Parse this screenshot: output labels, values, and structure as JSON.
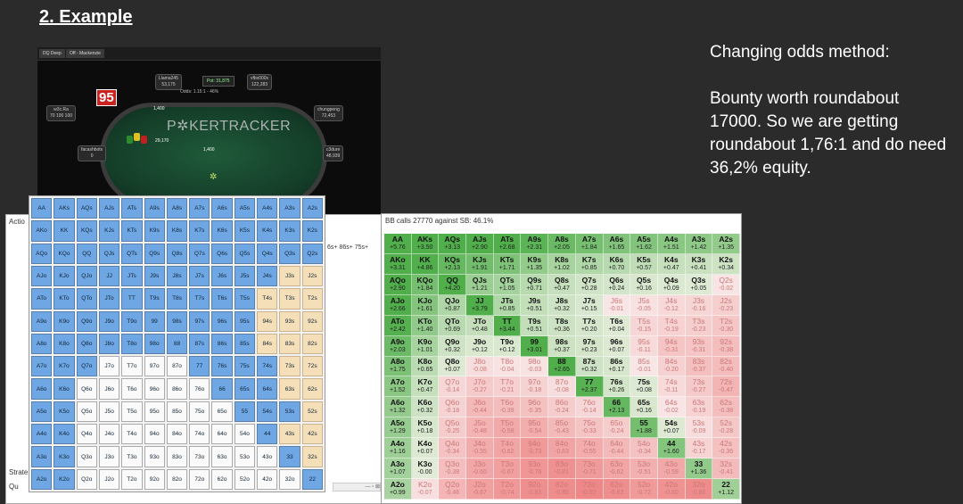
{
  "slide": {
    "title": "2. Example",
    "notes_heading": "Changing odds method:",
    "notes_body": "Bounty worth roundabout 17000. So we are getting roundabout 1,76:1 and do need 36,2% equity."
  },
  "table": {
    "tabs": [
      "DQ Deep",
      "Off - Mackenzie"
    ],
    "brand": "P✲KERTRACKER",
    "card_overlay": "95",
    "pot": "Pot: 31,875",
    "odds": "Odds: 1.15:1 - 46%",
    "stacks": {
      "top_left": "Llama245\n53,175",
      "top_right": "vfbx000x\n122,283",
      "left": "w3c.Ra\n70 100 100",
      "right_mid": "chungpeng\n72,453",
      "bottom_left": "facashbots\n0",
      "bottom_right": "c3dure\n48,939"
    },
    "bets": {
      "left": "1,400",
      "center": "29,170",
      "bottom": "1,400"
    }
  },
  "left_window": {
    "action_label": "Actio",
    "strategy_label": "Strate",
    "search_label": "Qu",
    "overflow_text": "6s+ 86s+ 75s+"
  },
  "range_grid": {
    "rows": [
      [
        "AA",
        "AKs",
        "AQs",
        "AJs",
        "ATs",
        "A9s",
        "A8s",
        "A7s",
        "A6s",
        "A5s",
        "A4s",
        "A3s",
        "A2s"
      ],
      [
        "AKo",
        "KK",
        "KQs",
        "KJs",
        "KTs",
        "K9s",
        "K8s",
        "K7s",
        "K6s",
        "K5s",
        "K4s",
        "K3s",
        "K2s"
      ],
      [
        "AQo",
        "KQo",
        "QQ",
        "QJs",
        "QTs",
        "Q9s",
        "Q8s",
        "Q7s",
        "Q6s",
        "Q5s",
        "Q4s",
        "Q3s",
        "Q2s"
      ],
      [
        "AJo",
        "KJo",
        "QJo",
        "JJ",
        "JTs",
        "J9s",
        "J8s",
        "J7s",
        "J6s",
        "J5s",
        "J4s",
        "J3s",
        "J2s"
      ],
      [
        "ATo",
        "KTo",
        "QTo",
        "JTo",
        "TT",
        "T9s",
        "T8s",
        "T7s",
        "T6s",
        "T5s",
        "T4s",
        "T3s",
        "T2s"
      ],
      [
        "A9o",
        "K9o",
        "Q9o",
        "J9o",
        "T9o",
        "99",
        "98s",
        "97s",
        "96s",
        "95s",
        "94s",
        "93s",
        "92s"
      ],
      [
        "A8o",
        "K8o",
        "Q8o",
        "J8o",
        "T8o",
        "98o",
        "88",
        "87s",
        "86s",
        "85s",
        "84s",
        "83s",
        "82s"
      ],
      [
        "A7o",
        "K7o",
        "Q7o",
        "J7o",
        "T7o",
        "97o",
        "87o",
        "77",
        "76s",
        "75s",
        "74s",
        "73s",
        "72s"
      ],
      [
        "A6o",
        "K6o",
        "Q6o",
        "J6o",
        "T6o",
        "96o",
        "86o",
        "76o",
        "66",
        "65s",
        "64s",
        "63s",
        "62s"
      ],
      [
        "A5o",
        "K5o",
        "Q5o",
        "J5o",
        "T5o",
        "95o",
        "85o",
        "75o",
        "65o",
        "55",
        "54s",
        "53s",
        "52s"
      ],
      [
        "A4o",
        "K4o",
        "Q4o",
        "J4o",
        "T4o",
        "94o",
        "84o",
        "74o",
        "64o",
        "54o",
        "44",
        "43s",
        "42s"
      ],
      [
        "A3o",
        "K3o",
        "Q3o",
        "J3o",
        "T3o",
        "93o",
        "83o",
        "73o",
        "63o",
        "53o",
        "43o",
        "33",
        "32s"
      ],
      [
        "A2o",
        "K2o",
        "Q2o",
        "J2o",
        "T2o",
        "92o",
        "82o",
        "72o",
        "62o",
        "52o",
        "42o",
        "32o",
        "22"
      ]
    ]
  },
  "equity": {
    "header": "BB calls 27770 against SB: 46.1%",
    "values": [
      [
        "+5.76",
        "+3.50",
        "+3.13",
        "+2.90",
        "+2.68",
        "+2.31",
        "+2.05",
        "+1.84",
        "+1.65",
        "+1.62",
        "+1.51",
        "+1.42",
        "+1.35"
      ],
      [
        "+3.31",
        "+4.86",
        "+2.13",
        "+1.91",
        "+1.71",
        "+1.35",
        "+1.02",
        "+0.85",
        "+0.70",
        "+0.57",
        "+0.47",
        "+0.41",
        "+0.34"
      ],
      [
        "+2.90",
        "+1.84",
        "+4.20",
        "+1.21",
        "+1.05",
        "+0.71",
        "+0.47",
        "+0.28",
        "+0.24",
        "+0.16",
        "+0.09",
        "+0.05",
        "-0.02"
      ],
      [
        "+2.66",
        "+1.61",
        "+0.87",
        "+3.79",
        "+0.85",
        "+0.51",
        "+0.32",
        "+0.15",
        "-0.01",
        "-0.05",
        "-0.12",
        "-0.16",
        "-0.23"
      ],
      [
        "+2.42",
        "+1.40",
        "+0.69",
        "+0.48",
        "+3.44",
        "+0.51",
        "+0.36",
        "+0.20",
        "+0.04",
        "-0.15",
        "-0.19",
        "-0.23",
        "-0.30"
      ],
      [
        "+2.03",
        "+1.01",
        "+0.32",
        "+0.12",
        "+0.12",
        "+3.01",
        "+0.37",
        "+0.23",
        "+0.07",
        "-0.11",
        "-0.31",
        "-0.31",
        "-0.38"
      ],
      [
        "+1.75",
        "+0.65",
        "+0.07",
        "-0.08",
        "-0.04",
        "-0.03",
        "+2.65",
        "+0.32",
        "+0.17",
        "-0.01",
        "-0.20",
        "-0.37",
        "-0.40"
      ],
      [
        "+1.52",
        "+0.47",
        "-0.14",
        "-0.27",
        "-0.21",
        "-0.18",
        "-0.08",
        "+2.37",
        "+0.26",
        "+0.08",
        "-0.11",
        "-0.27",
        "-0.47"
      ],
      [
        "+1.32",
        "+0.32",
        "-0.18",
        "-0.44",
        "-0.39",
        "-0.35",
        "-0.24",
        "-0.14",
        "+2.13",
        "+0.16",
        "-0.02",
        "-0.19",
        "-0.38"
      ],
      [
        "+1.29",
        "+0.18",
        "-0.25",
        "-0.48",
        "-0.58",
        "-0.54",
        "-0.43",
        "-0.33",
        "-0.24",
        "+1.88",
        "+0.07",
        "-0.09",
        "-0.28"
      ],
      [
        "+1.16",
        "+0.07",
        "-0.34",
        "-0.55",
        "-0.62",
        "-0.73",
        "-0.63",
        "-0.55",
        "-0.44",
        "-0.34",
        "+1.60",
        "-0.17",
        "-0.36"
      ],
      [
        "+1.07",
        "-0.00",
        "-0.38",
        "-0.60",
        "-0.67",
        "-0.76",
        "-0.81",
        "-0.71",
        "-0.62",
        "-0.51",
        "-0.59",
        "+1.36",
        "-0.41"
      ],
      [
        "+0.99",
        "-0.07",
        "-0.46",
        "-0.67",
        "-0.74",
        "-0.83",
        "-0.85",
        "-0.92",
        "-0.83",
        "-0.72",
        "-0.80",
        "-0.86",
        "+1.12"
      ]
    ]
  },
  "colors": {
    "range_blue": "#6ea7e4",
    "range_tan": "#f4dfb8",
    "green_strong": "#4fc04f",
    "red_strong": "#f09090"
  }
}
